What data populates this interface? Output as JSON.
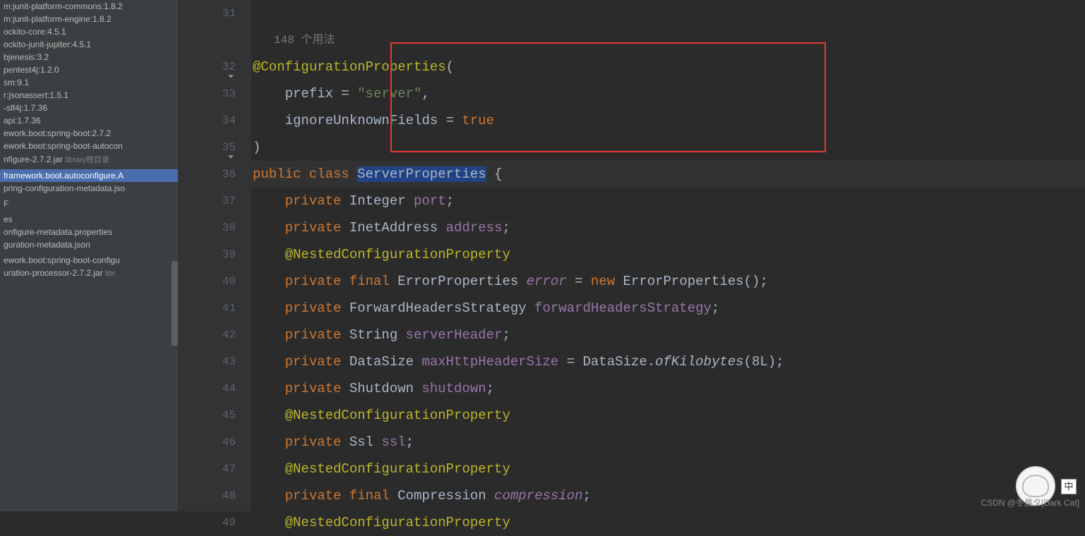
{
  "sidebar": {
    "items": [
      {
        "label": "m:junit-platform-commons:1.8.2"
      },
      {
        "label": "m:junit-platform-engine:1.8.2"
      },
      {
        "label": "ockito-core:4.5.1"
      },
      {
        "label": "ockito-junit-jupiter:4.5.1"
      },
      {
        "label": "bjenesis:3.2"
      },
      {
        "label": "pentest4j:1.2.0"
      },
      {
        "label": "sm:9.1"
      },
      {
        "label": "r:jsonassert:1.5.1"
      },
      {
        "label": "-slf4j:1.7.36"
      },
      {
        "label": "api:1.7.36"
      },
      {
        "label": "ework.boot:spring-boot:2.7.2"
      },
      {
        "label": "ework.boot:spring-boot-autocon"
      },
      {
        "label": "nfigure-2.7.2.jar",
        "tag": "library根目录"
      },
      {
        "label": ""
      },
      {
        "label": "framework.boot.autoconfigure.A",
        "highlighted": true
      },
      {
        "label": "pring-configuration-metadata.jso"
      },
      {
        "label": ""
      },
      {
        "label": "F"
      },
      {
        "label": ""
      },
      {
        "label": "es"
      },
      {
        "label": "onfigure-metadata.properties"
      },
      {
        "label": "guration-metadata.json"
      },
      {
        "label": ""
      },
      {
        "label": "ework.boot:spring-boot-configu"
      },
      {
        "label": "uration-processor-2.7.2.jar",
        "tag": "libr"
      }
    ]
  },
  "editor": {
    "usage_hint": "148 个用法",
    "lines": [
      {
        "n": "31",
        "tokens": []
      },
      {
        "n": "",
        "usage": true
      },
      {
        "n": "32",
        "tokens": [
          [
            "anno",
            "@ConfigurationProperties"
          ],
          [
            "punct",
            "("
          ]
        ],
        "collapse": true
      },
      {
        "n": "33",
        "tokens": [
          [
            "punct",
            "    prefix = "
          ],
          [
            "str",
            "\"server\""
          ],
          [
            "punct",
            ","
          ]
        ]
      },
      {
        "n": "34",
        "tokens": [
          [
            "punct",
            "    ignoreUnknownFields = "
          ],
          [
            "kw",
            "true"
          ]
        ]
      },
      {
        "n": "35",
        "tokens": [
          [
            "punct",
            ")"
          ]
        ],
        "collapse_end": true
      },
      {
        "n": "36",
        "current": true,
        "tokens": [
          [
            "kw",
            "public class "
          ],
          [
            "sel-class",
            "ServerProperties"
          ],
          [
            "punct",
            " {"
          ]
        ]
      },
      {
        "n": "37",
        "tokens": [
          [
            "kw",
            "    private "
          ],
          [
            "cls",
            "Integer "
          ],
          [
            "field",
            "port"
          ],
          [
            "punct",
            ";"
          ]
        ]
      },
      {
        "n": "38",
        "tokens": [
          [
            "kw",
            "    private "
          ],
          [
            "cls",
            "InetAddress "
          ],
          [
            "field",
            "address"
          ],
          [
            "punct",
            ";"
          ]
        ]
      },
      {
        "n": "39",
        "tokens": [
          [
            "anno",
            "    @NestedConfigurationProperty"
          ]
        ]
      },
      {
        "n": "40",
        "tokens": [
          [
            "kw",
            "    private final "
          ],
          [
            "cls",
            "ErrorProperties "
          ],
          [
            "param-italic",
            "error"
          ],
          [
            "punct",
            " = "
          ],
          [
            "kw",
            "new "
          ],
          [
            "cls",
            "ErrorProperties();"
          ]
        ]
      },
      {
        "n": "41",
        "tokens": [
          [
            "kw",
            "    private "
          ],
          [
            "cls",
            "ForwardHeadersStrategy "
          ],
          [
            "field",
            "forwardHeadersStrategy"
          ],
          [
            "punct",
            ";"
          ]
        ]
      },
      {
        "n": "42",
        "tokens": [
          [
            "kw",
            "    private "
          ],
          [
            "cls",
            "String "
          ],
          [
            "field",
            "serverHeader"
          ],
          [
            "punct",
            ";"
          ]
        ]
      },
      {
        "n": "43",
        "tokens": [
          [
            "kw",
            "    private "
          ],
          [
            "cls",
            "DataSize "
          ],
          [
            "field",
            "maxHttpHeaderSize"
          ],
          [
            "punct",
            " = DataSize."
          ],
          [
            "method-italic",
            "ofKilobytes"
          ],
          [
            "punct",
            "(8L);"
          ]
        ]
      },
      {
        "n": "44",
        "tokens": [
          [
            "kw",
            "    private "
          ],
          [
            "cls",
            "Shutdown "
          ],
          [
            "field",
            "shutdown"
          ],
          [
            "punct",
            ";"
          ]
        ]
      },
      {
        "n": "45",
        "tokens": [
          [
            "anno",
            "    @NestedConfigurationProperty"
          ]
        ]
      },
      {
        "n": "46",
        "tokens": [
          [
            "kw",
            "    private "
          ],
          [
            "cls",
            "Ssl "
          ],
          [
            "field",
            "ssl"
          ],
          [
            "punct",
            ";"
          ]
        ]
      },
      {
        "n": "47",
        "tokens": [
          [
            "anno",
            "    @NestedConfigurationProperty"
          ]
        ]
      },
      {
        "n": "48",
        "tokens": [
          [
            "kw",
            "    private final "
          ],
          [
            "cls",
            "Compression "
          ],
          [
            "param-italic",
            "compression"
          ],
          [
            "punct",
            ";"
          ]
        ]
      },
      {
        "n": "49",
        "tokens": [
          [
            "anno",
            "    @NestedConfigurationProperty"
          ]
        ]
      }
    ]
  },
  "watermark": "CSDN @冬晨夕[Dark Cat]",
  "ime": "中"
}
